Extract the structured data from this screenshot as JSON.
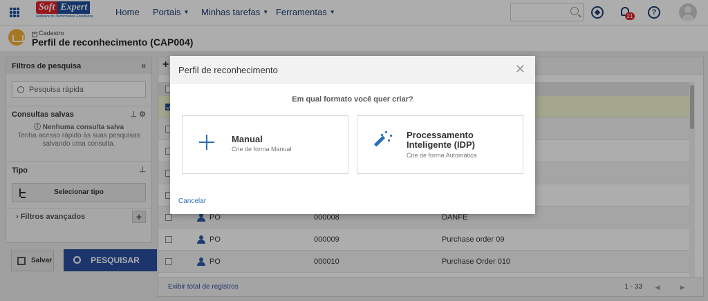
{
  "topnav": {
    "logo_soft": "Soft",
    "logo_expert": "Expert",
    "logo_tagline": "Software for Performance Excellence",
    "items": [
      {
        "label": "Home"
      },
      {
        "label": "Portais"
      },
      {
        "label": "Minhas tarefas"
      },
      {
        "label": "Ferramentas"
      }
    ],
    "notification_count": "21"
  },
  "page": {
    "breadcrumb": "Cadastro",
    "title": "Perfil de reconhecimento (CAP004)"
  },
  "filters": {
    "header": "Filtros de pesquisa",
    "quick_search_placeholder": "Pesquisa rápida",
    "saved_queries": "Consultas salvas",
    "no_query_title": "Nenhuma consulta salva",
    "no_query_text": "Tenha acesso rápido às suas pesquisas salvando uma consulta.",
    "type_label": "Tipo",
    "select_type": "Selecionar tipo",
    "advanced": "Filtros avançados",
    "save_label": "Salvar",
    "search_label": "PESQUISAR"
  },
  "grid": {
    "rows": [
      {
        "col1": "PO",
        "col2": "000008",
        "col3": "DANFE"
      },
      {
        "col1": "PO",
        "col2": "000009",
        "col3": "Purchase order 09"
      },
      {
        "col1": "PO",
        "col2": "000010",
        "col3": "Purchase Order 010"
      }
    ],
    "show_total": "Exibir total de registros",
    "range": "1 - 33"
  },
  "modal": {
    "title": "Perfil de reconhecimento",
    "question": "Em qual formato você quer criar?",
    "options": [
      {
        "title": "Manual",
        "subtitle": "Crie de forma Manual"
      },
      {
        "title_line1": "Processamento",
        "title_line2": "Inteligente (IDP)",
        "subtitle": "Crie de forma Automática"
      }
    ],
    "cancel": "Cancelar"
  },
  "colors": {
    "brand_blue": "#1e4f9c",
    "brand_red": "#e2232a",
    "accent": "#2a6db8"
  }
}
